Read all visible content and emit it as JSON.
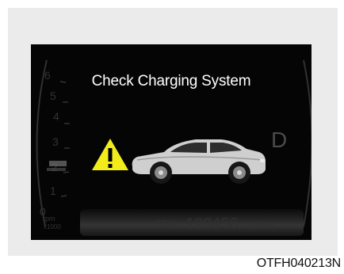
{
  "display": {
    "message": "Check Charging System",
    "gear": "D",
    "odometer": {
      "label": "ODO",
      "value": "123456",
      "unit": "miles"
    },
    "tachometer": {
      "ticks": [
        "0",
        "1",
        "2",
        "3",
        "4",
        "5",
        "6"
      ],
      "unit": "rpm",
      "multiplier": "x1000"
    }
  },
  "caption": "OTFH040213N",
  "icons": {
    "warning": "warning-triangle-icon",
    "vehicle": "car-icon"
  },
  "colors": {
    "warning": "#f2ed1a",
    "display_bg": "#050505",
    "text": "#ffffff"
  }
}
